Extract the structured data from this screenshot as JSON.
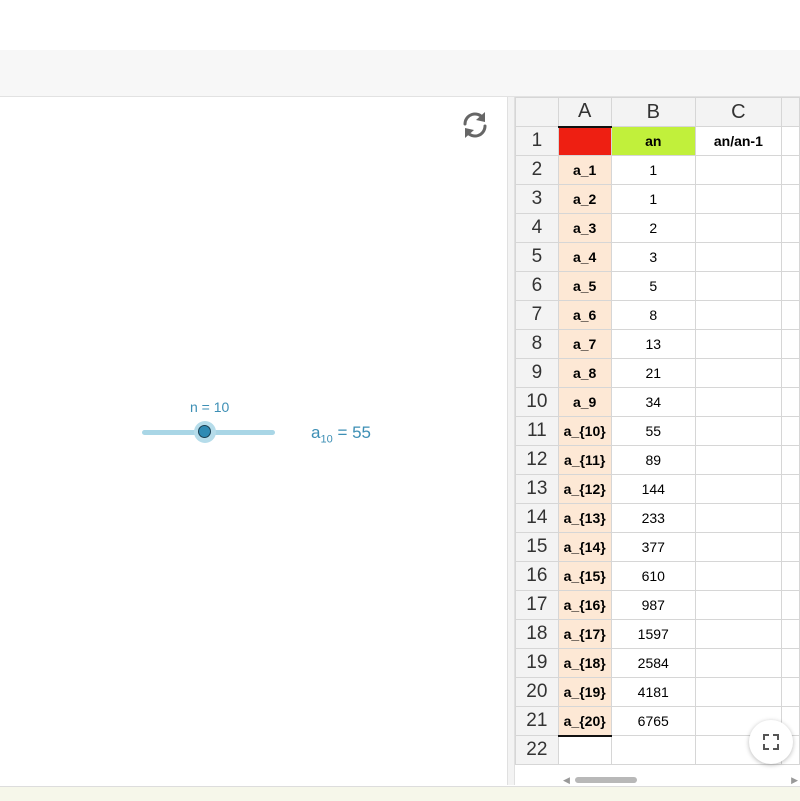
{
  "graphics": {
    "slider": {
      "label": "n = 10",
      "value": 10,
      "min": 1,
      "max": 20
    },
    "sequence_display": {
      "name": "a",
      "subscript": "10",
      "equals": "= 55"
    },
    "refresh_icon": "refresh-icon"
  },
  "spreadsheet": {
    "columns": [
      "A",
      "B",
      "C"
    ],
    "row_numbers": [
      "1",
      "2",
      "3",
      "4",
      "5",
      "6",
      "7",
      "8",
      "9",
      "10",
      "11",
      "12",
      "13",
      "14",
      "15",
      "16",
      "17",
      "18",
      "19",
      "20",
      "21",
      "22"
    ],
    "header_row": {
      "A": "",
      "B": "an",
      "C": "an/an-1"
    },
    "colors": {
      "A1": "#ee1f12",
      "B1": "#c1f03b",
      "col_A": "#fde8d5"
    },
    "rows": [
      {
        "A": "a_1",
        "B": "1"
      },
      {
        "A": "a_2",
        "B": "1"
      },
      {
        "A": "a_3",
        "B": "2"
      },
      {
        "A": "a_4",
        "B": "3"
      },
      {
        "A": "a_5",
        "B": "5"
      },
      {
        "A": "a_6",
        "B": "8"
      },
      {
        "A": "a_7",
        "B": "13"
      },
      {
        "A": "a_8",
        "B": "21"
      },
      {
        "A": "a_9",
        "B": "34"
      },
      {
        "A": "a_{10}",
        "B": "55"
      },
      {
        "A": "a_{11}",
        "B": "89"
      },
      {
        "A": "a_{12}",
        "B": "144"
      },
      {
        "A": "a_{13}",
        "B": "233"
      },
      {
        "A": "a_{14}",
        "B": "377"
      },
      {
        "A": "a_{15}",
        "B": "610"
      },
      {
        "A": "a_{16}",
        "B": "987"
      },
      {
        "A": "a_{17}",
        "B": "1597"
      },
      {
        "A": "a_{18}",
        "B": "2584"
      },
      {
        "A": "a_{19}",
        "B": "4181"
      },
      {
        "A": "a_{20}",
        "B": "6765"
      }
    ]
  },
  "fullscreen_icon": "fullscreen-icon"
}
